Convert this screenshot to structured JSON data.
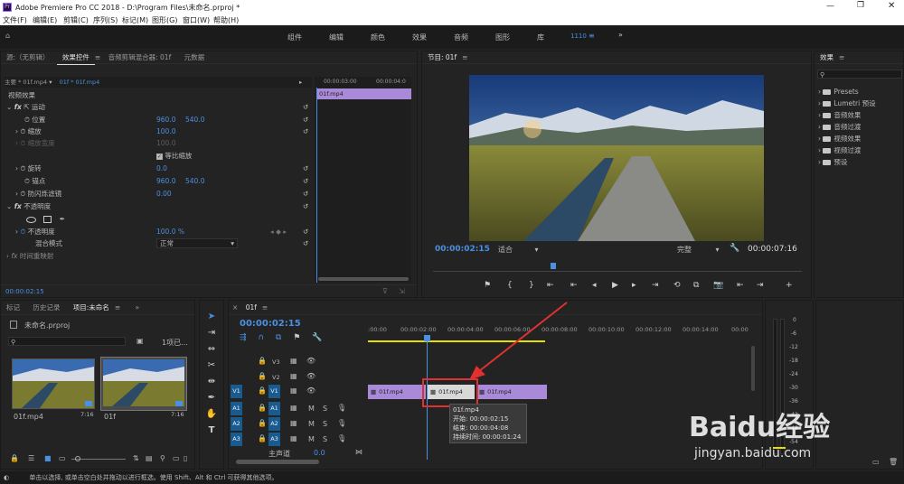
{
  "app": {
    "title": "Adobe Premiere Pro CC 2018 - D:\\Program Files\\未命名.prproj *"
  },
  "menu": [
    "文件(F)",
    "编辑(E)",
    "剪辑(C)",
    "序列(S)",
    "标记(M)",
    "图形(G)",
    "窗口(W)",
    "帮助(H)"
  ],
  "workspaces": {
    "items": [
      "组件",
      "编辑",
      "颜色",
      "效果",
      "音频",
      "图形",
      "库"
    ],
    "active": "1110",
    "more": "»"
  },
  "source_panel": {
    "tabs": [
      "源:（无剪辑）",
      "效果控件",
      "音频剪辑混合器: 01f",
      "元数据"
    ],
    "seq_tabs": [
      "主要 * 01f.mp4",
      "01f * 01f.mp4"
    ],
    "ruler": [
      "00:00:03:00",
      "00:00:04:0"
    ],
    "clip_label": "01f.mp4",
    "sections": {
      "video": "视频效果",
      "motion": "运动",
      "opacity": "不透明度",
      "remap": "时间重映射"
    },
    "props": {
      "position_label": "位置",
      "position_x": "960.0",
      "position_y": "540.0",
      "scale_label": "缩放",
      "scale_val": "100.0",
      "scale_width_label": "缩放宽度",
      "scale_width_val": "100.0",
      "uniform_label": "等比缩放",
      "rotation_label": "旋转",
      "rotation_val": "0.0",
      "anchor_label": "锚点",
      "anchor_x": "960.0",
      "anchor_y": "540.0",
      "flicker_label": "防闪烁滤镜",
      "flicker_val": "0.00",
      "opacity_label": "不透明度",
      "opacity_val": "100.0 %",
      "blend_label": "混合模式",
      "blend_val": "正常"
    },
    "timecode": "00:00:02:15"
  },
  "program_monitor": {
    "title": "节目: 01f",
    "timecode": "00:00:02:15",
    "fit": "适合",
    "quality": "完整",
    "duration": "00:00:07:16"
  },
  "effects_panel": {
    "title": "效果",
    "items": [
      "Presets",
      "Lumetri 预设",
      "音频效果",
      "音频过渡",
      "视频效果",
      "视频过渡",
      "预设"
    ]
  },
  "project_panel": {
    "tabs": [
      "标记",
      "历史记录",
      "项目:未命名"
    ],
    "project_file": "未命名.prproj",
    "count": "1项已...",
    "items": [
      {
        "name": "01f.mp4",
        "duration": "7:16"
      },
      {
        "name": "01f",
        "duration": "7:16"
      }
    ]
  },
  "timeline": {
    "tab": "01f",
    "timecode": "00:00:02:15",
    "ruler": [
      ":00:00",
      "00:00:02:00",
      "00:00:04:00",
      "00:00:06:00",
      "00:00:08:00",
      "00:00:10:00",
      "00:00:12:00",
      "00:00:14:00",
      "00:00"
    ],
    "video_tracks": [
      "V3",
      "V2",
      "V1"
    ],
    "audio_tracks": [
      "A1",
      "A2",
      "A3"
    ],
    "master": {
      "label": "主声道",
      "value": "0.0"
    },
    "clips": [
      "01f.mp4",
      "01f.mp4",
      "01f.mp4"
    ],
    "tooltip": {
      "name": "01f.mp4",
      "start": "开始: 00:00:02:15",
      "end": "结束: 00:00:04:08",
      "duration": "持续时间: 00:00:01:24"
    }
  },
  "meter": {
    "labels": [
      "0",
      "-6",
      "-12",
      "-18",
      "-24",
      "-30",
      "-36",
      "-42",
      "-48",
      "-54"
    ]
  },
  "statusbar": {
    "text": "单击以选择, 或单击空白处并拖动以进行框选。使用 Shift、Alt 和 Ctrl 可获得其他选项。"
  },
  "watermark": {
    "main": "Baidu经验",
    "url": "jingyan.baidu.com"
  },
  "colors": {
    "accent": "#4a90e2",
    "clip": "#a88ad8",
    "yellow": "#e5e000",
    "red": "#e03030"
  }
}
